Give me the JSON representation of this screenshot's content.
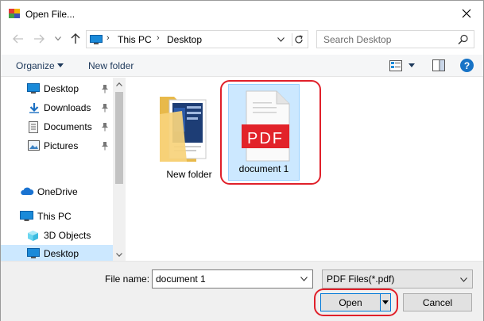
{
  "window": {
    "title": "Open File..."
  },
  "address": {
    "crumbs": [
      "This PC",
      "Desktop"
    ],
    "separator": "›"
  },
  "search": {
    "placeholder": "Search Desktop"
  },
  "toolbar": {
    "organize_label": "Organize",
    "new_folder_label": "New folder",
    "help_label": "?"
  },
  "navigation": {
    "quick_access": [
      {
        "label": "Desktop",
        "icon": "desktop-icon",
        "pinned": true
      },
      {
        "label": "Downloads",
        "icon": "download-arrow-icon",
        "pinned": true
      },
      {
        "label": "Documents",
        "icon": "documents-icon",
        "pinned": true
      },
      {
        "label": "Pictures",
        "icon": "pictures-icon",
        "pinned": true
      }
    ],
    "onedrive": {
      "label": "OneDrive",
      "icon": "cloud-icon"
    },
    "this_pc": {
      "label": "This PC",
      "icon": "computer-icon"
    },
    "this_pc_children": [
      {
        "label": "3D Objects",
        "icon": "cube-icon"
      },
      {
        "label": "Desktop",
        "icon": "desktop-icon",
        "selected": true
      }
    ]
  },
  "files": [
    {
      "name": "New folder",
      "type": "folder",
      "icon": "folder-icon",
      "selected": false
    },
    {
      "name": "document 1",
      "type": "pdf",
      "icon": "pdf-file-icon",
      "badge": "PDF",
      "selected": true
    }
  ],
  "bottom": {
    "file_name_label": "File name:",
    "file_name_value": "document 1",
    "file_type_value": "PDF Files(*.pdf)",
    "open_label": "Open",
    "cancel_label": "Cancel"
  },
  "colors": {
    "accent": "#0078d7",
    "selection": "#cce8ff",
    "highlight_ring": "#e0202a",
    "pdf_red": "#e2232a"
  }
}
